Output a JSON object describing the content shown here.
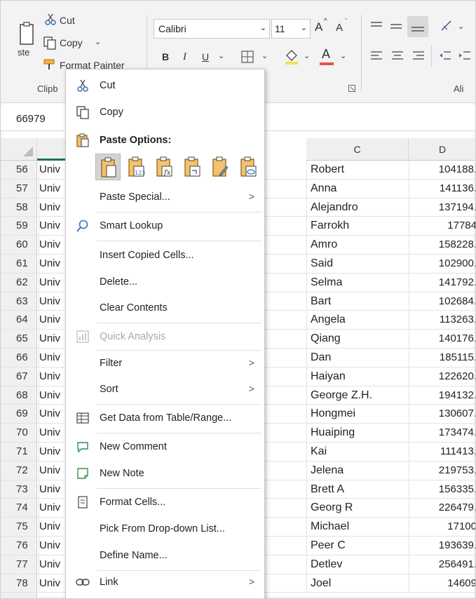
{
  "ribbon": {
    "clipboard": {
      "cut_label": "Cut",
      "copy_label": "Copy",
      "format_painter_label": "Format Painter",
      "paste_label": "ste",
      "group_label": "Clipb"
    },
    "font": {
      "font_name": "Calibri",
      "font_size": "11",
      "grow_label": "A",
      "shrink_label": "A",
      "bold": "B",
      "italic": "I",
      "underline": "U",
      "font_color_letter": "A"
    },
    "alignment": {
      "group_label": "Ali"
    },
    "accent_color": "#e8534a"
  },
  "namebox": {
    "value": "66979"
  },
  "columns": [
    "C",
    "D"
  ],
  "rows": [
    {
      "num": "56",
      "a": "Univ",
      "c": "Robert",
      "d": "104188."
    },
    {
      "num": "57",
      "a": "Univ",
      "c": "Anna",
      "d": "141136."
    },
    {
      "num": "58",
      "a": "Univ",
      "c": "Alejandro",
      "d": "137194."
    },
    {
      "num": "59",
      "a": "Univ",
      "c": "Farrokh",
      "d": "17784"
    },
    {
      "num": "60",
      "a": "Univ",
      "c": "Amro",
      "d": "158228."
    },
    {
      "num": "61",
      "a": "Univ",
      "c": "Said",
      "d": "102900."
    },
    {
      "num": "62",
      "a": "Univ",
      "c": "Selma",
      "d": "141792."
    },
    {
      "num": "63",
      "a": "Univ",
      "c": "Bart",
      "d": "102684."
    },
    {
      "num": "64",
      "a": "Univ",
      "c": "Angela",
      "d": "113263."
    },
    {
      "num": "65",
      "a": "Univ",
      "c": "Qiang",
      "d": "140176."
    },
    {
      "num": "66",
      "a": "Univ",
      "c": "Dan",
      "d": "185115."
    },
    {
      "num": "67",
      "a": "Univ",
      "c": "Haiyan",
      "d": "122620."
    },
    {
      "num": "68",
      "a": "Univ",
      "c": "George Z.H.",
      "d": "194132."
    },
    {
      "num": "69",
      "a": "Univ",
      "c": "Hongmei",
      "d": "130607."
    },
    {
      "num": "70",
      "a": "Univ",
      "c": "Huaiping",
      "d": "173474."
    },
    {
      "num": "71",
      "a": "Univ",
      "c": "Kai",
      "d": "111413."
    },
    {
      "num": "72",
      "a": "Univ",
      "c": "Jelena",
      "d": "219753."
    },
    {
      "num": "73",
      "a": "Univ",
      "c": "Brett A",
      "d": "156335."
    },
    {
      "num": "74",
      "a": "Univ",
      "c": "Georg R",
      "d": "226479."
    },
    {
      "num": "75",
      "a": "Univ",
      "c": "Michael",
      "d": "17100"
    },
    {
      "num": "76",
      "a": "Univ",
      "c": "Peer C",
      "d": "193639."
    },
    {
      "num": "77",
      "a": "Univ",
      "c": "Detlev",
      "d": "256491."
    },
    {
      "num": "78",
      "a": "Univ",
      "c": "Joel",
      "d": "14609"
    }
  ],
  "menu": {
    "cut": "Cut",
    "copy": "Copy",
    "paste_options": "Paste Options:",
    "paste_special": "Paste Special...",
    "smart_lookup": "Smart Lookup",
    "insert_copied": "Insert Copied Cells...",
    "delete": "Delete...",
    "clear_contents": "Clear Contents",
    "quick_analysis": "Quick Analysis",
    "filter": "Filter",
    "sort": "Sort",
    "get_data": "Get Data from Table/Range...",
    "new_comment": "New Comment",
    "new_note": "New Note",
    "format_cells": "Format Cells...",
    "pick_list": "Pick From Drop-down List...",
    "define_name": "Define Name...",
    "link": "Link",
    "submenu_arrow": ">"
  }
}
